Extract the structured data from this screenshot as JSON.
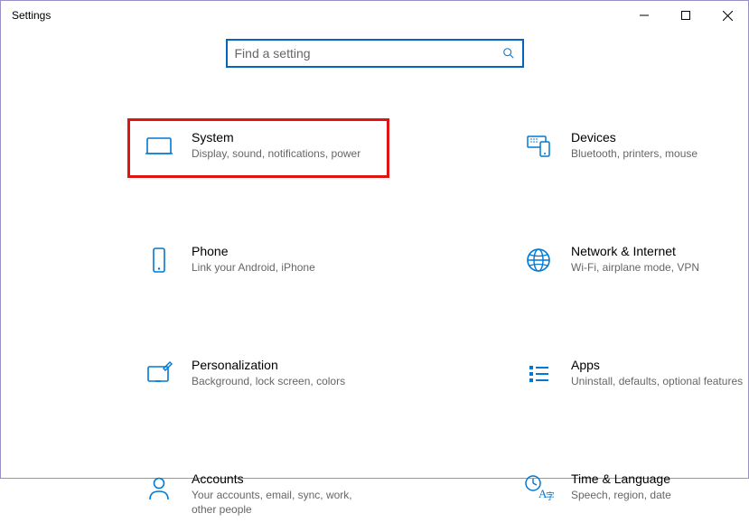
{
  "window": {
    "title": "Settings"
  },
  "search": {
    "placeholder": "Find a setting"
  },
  "categories": {
    "system": {
      "title": "System",
      "desc": "Display, sound, notifications, power"
    },
    "devices": {
      "title": "Devices",
      "desc": "Bluetooth, printers, mouse"
    },
    "phone": {
      "title": "Phone",
      "desc": "Link your Android, iPhone"
    },
    "network": {
      "title": "Network & Internet",
      "desc": "Wi-Fi, airplane mode, VPN"
    },
    "personalization": {
      "title": "Personalization",
      "desc": "Background, lock screen, colors"
    },
    "apps": {
      "title": "Apps",
      "desc": "Uninstall, defaults, optional features"
    },
    "accounts": {
      "title": "Accounts",
      "desc": "Your accounts, email, sync, work, other people"
    },
    "time": {
      "title": "Time & Language",
      "desc": "Speech, region, date"
    }
  },
  "colors": {
    "accent": "#0078d4",
    "highlight": "#e11414"
  }
}
